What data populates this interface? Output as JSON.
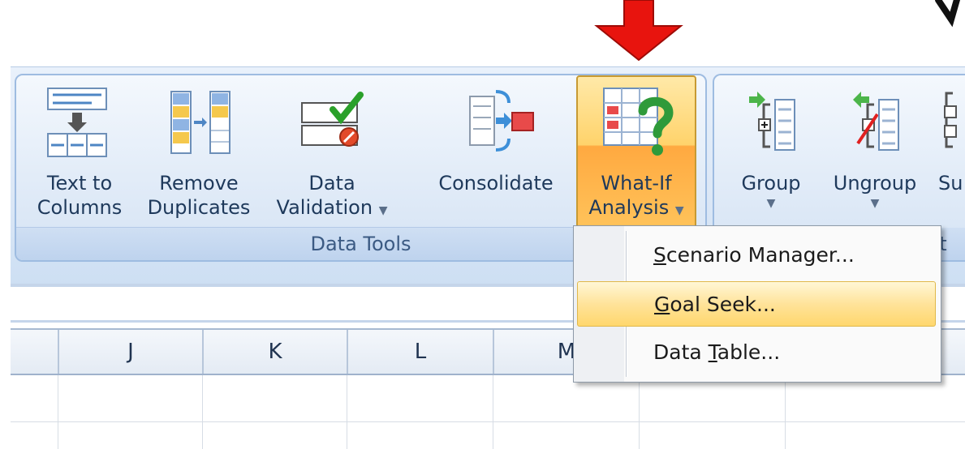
{
  "ribbon": {
    "group_data_tools_label": "Data Tools",
    "group_outline_label_fragment": "ut",
    "buttons": [
      {
        "line1": "Text to",
        "line2": "Columns",
        "icon": "text-to-columns-icon"
      },
      {
        "line1": "Remove",
        "line2": "Duplicates",
        "icon": "remove-duplicates-icon"
      },
      {
        "line1": "Data",
        "line2": "Validation",
        "icon": "data-validation-icon",
        "has_dropdown": true
      },
      {
        "line1": "Consolidate",
        "line2": "",
        "icon": "consolidate-icon"
      },
      {
        "line1": "What-If",
        "line2": "Analysis",
        "icon": "what-if-analysis-icon",
        "has_dropdown": true,
        "state": "active"
      },
      {
        "line1": "Group",
        "icon": "group-icon",
        "has_dropdown": true
      },
      {
        "line1": "Ungroup",
        "icon": "ungroup-icon",
        "has_dropdown": true
      },
      {
        "line1": "Su",
        "icon": "subtotal-icon"
      }
    ]
  },
  "dropdown_menu": {
    "items": [
      {
        "prefix": "",
        "accel": "S",
        "suffix": "cenario Manager...",
        "state": "normal"
      },
      {
        "prefix": "",
        "accel": "G",
        "suffix": "oal Seek...",
        "state": "highlighted"
      },
      {
        "prefix": "Data ",
        "accel": "T",
        "suffix": "able...",
        "state": "normal"
      }
    ]
  },
  "sheet": {
    "column_headers": [
      "J",
      "K",
      "L",
      "M"
    ]
  },
  "annotation": {
    "arrow_color": "#e8140e",
    "arrow_icon": "red-down-arrow-icon"
  },
  "colors": {
    "ribbon_bg": "#dbe7f6",
    "group_border": "#9ebce1",
    "active_button": "#ffc35a",
    "menu_highlight": "#ffe39a"
  }
}
